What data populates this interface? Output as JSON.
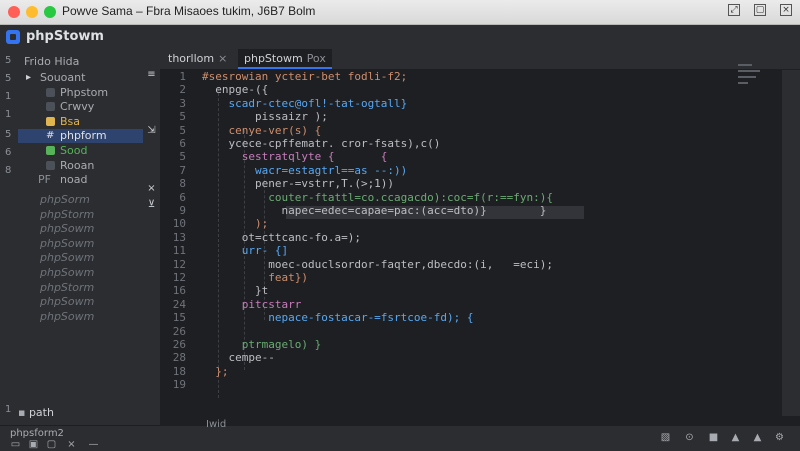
{
  "window": {
    "title": "Powve Sama – Fbra Misaoes tukim, J6B7 Bolm"
  },
  "app": {
    "name": "phpStowm"
  },
  "gutter_numbers": [
    "5",
    "5",
    "1",
    "1",
    "5",
    "6",
    "8"
  ],
  "sidebar": {
    "header": "Frido    Hida",
    "items": [
      {
        "label": "Souoant",
        "icon": "folder-icon",
        "color": "#a9abb2",
        "indent": 1
      },
      {
        "label": "Phpstom",
        "icon": "php-icon",
        "color": "#a9abb2",
        "indent": 2
      },
      {
        "label": "Crwvy",
        "icon": "php-icon",
        "color": "#a9abb2",
        "indent": 2
      },
      {
        "label": "Bsa",
        "icon": "php-icon",
        "color": "#e0b44f",
        "indent": 2
      },
      {
        "label": "phpform",
        "icon": "hash-icon",
        "color": "#dfe1e5",
        "indent": 2,
        "selected": true
      },
      {
        "label": "Sood",
        "icon": "php-icon",
        "color": "#56b35a",
        "indent": 2
      },
      {
        "label": "Rooan",
        "icon": "php-icon",
        "color": "#a9abb2",
        "indent": 2
      },
      {
        "label": "noad",
        "icon": "file-icon",
        "color": "#a9abb2",
        "indent": 2,
        "prefix": "PF"
      }
    ],
    "ghost_items": [
      "phpSorm",
      "phpStorm",
      "phpSowm",
      "phpSowm",
      "phpSowm",
      "phpSowm",
      "phpStorm",
      "phpSowm",
      "phpSowm"
    ],
    "bottom_label": "path",
    "bottom_sub": "phpsform2"
  },
  "tabs": [
    {
      "label": "thorllom",
      "active": false,
      "close": "×"
    },
    {
      "label": "phpStowm",
      "active": true,
      "close": "Pox"
    }
  ],
  "editor": {
    "lines": [
      {
        "n": "1",
        "text": "#sesrowian ycteir-bet fodli-f2;"
      },
      {
        "n": "2",
        "text": "  enpge-({"
      },
      {
        "n": "3",
        "text": "    scadr-ctec@ofl!-tat-ogtall}"
      },
      {
        "n": "5",
        "text": "        pissaizr );"
      },
      {
        "n": "5",
        "text": "    cenye-ver(s) {"
      },
      {
        "n": "6",
        "text": "    ycece-cpffematr. cror-fsats),c()"
      },
      {
        "n": "5",
        "text": "      sestratqlyte {       {"
      },
      {
        "n": "7",
        "text": "        wacr=estagtrl==as --:))"
      },
      {
        "n": "8",
        "text": "        pener-=vstrr,T.(>;1))"
      },
      {
        "n": "6",
        "text": "          couter-ftattl=co.ccagacdo):coc=f(r:==fyn:){"
      },
      {
        "n": "9",
        "text": "            napec=edec=capae=pac:(acc=dto)}        }"
      },
      {
        "n": "10",
        "text": "        );"
      },
      {
        "n": "13",
        "text": "      ot=cttcanc-fo.a=);"
      },
      {
        "n": "11",
        "text": "      urr- {]"
      },
      {
        "n": "12",
        "text": "          moec-oduclsordor-faqter,dbecdo:(i,   =eci);"
      },
      {
        "n": "12",
        "text": "          feat})"
      },
      {
        "n": "16",
        "text": "        }t"
      },
      {
        "n": "24",
        "text": "      pitcstarr"
      },
      {
        "n": "15",
        "text": "          nepace-fostacar-=fsrtcoe-fd); {"
      },
      {
        "n": "26",
        "text": ""
      },
      {
        "n": "26",
        "text": "      ptrmagelo) }"
      },
      {
        "n": "28",
        "text": "    cempe--"
      },
      {
        "n": "18",
        "text": "  };"
      },
      {
        "n": "19",
        "text": ""
      }
    ]
  },
  "status": {
    "file": "Iwid"
  },
  "colors": {
    "accent": "#3574f0",
    "bg": "#1e1f22",
    "panel": "#2b2d30"
  }
}
